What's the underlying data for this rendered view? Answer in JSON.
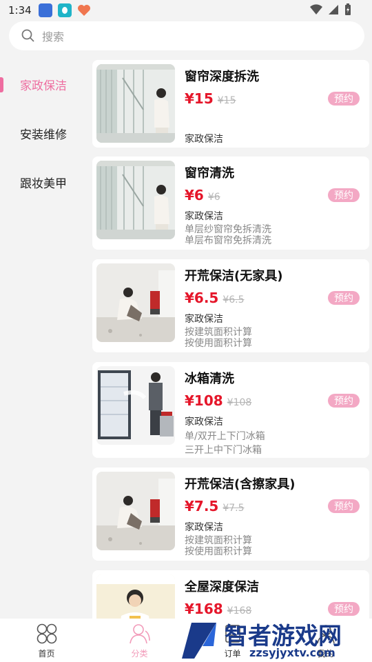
{
  "status_bar": {
    "time": "1:34"
  },
  "search": {
    "placeholder": "搜索"
  },
  "sidebar": {
    "items": [
      {
        "label": "家政保洁",
        "active": true
      },
      {
        "label": "安装维修",
        "active": false
      },
      {
        "label": "跟妆美甲",
        "active": false
      }
    ]
  },
  "cards": [
    {
      "title": "窗帘深度拆洗",
      "price": "¥15",
      "old_price": "¥15",
      "book": "预约",
      "category": "家政保洁",
      "desc": []
    },
    {
      "title": "窗帘清洗",
      "price": "¥6",
      "old_price": "¥6",
      "book": "预约",
      "category": "家政保洁",
      "desc": [
        "单层纱窗帘免拆清洗",
        "单层布窗帘免拆清洗"
      ]
    },
    {
      "title": "开荒保洁(无家具)",
      "price": "¥6.5",
      "old_price": "¥6.5",
      "book": "预约",
      "category": "家政保洁",
      "desc": [
        "按建筑面积计算",
        "按使用面积计算"
      ]
    },
    {
      "title": "冰箱清洗",
      "price": "¥108",
      "old_price": "¥108",
      "book": "预约",
      "category": "家政保洁",
      "desc": [
        "单/双开上下门冰箱",
        "三开上中下门冰箱"
      ]
    },
    {
      "title": "开荒保洁(含擦家具)",
      "price": "¥7.5",
      "old_price": "¥7.5",
      "book": "预约",
      "category": "家政保洁",
      "desc": [
        "按建筑面积计算",
        "按使用面积计算"
      ]
    },
    {
      "title": "全屋深度保洁",
      "price": "¥168",
      "old_price": "¥168",
      "book": "预约",
      "category": "",
      "desc": []
    }
  ],
  "bottom_nav": [
    {
      "label": "首页",
      "icon": "grid-icon",
      "active": false
    },
    {
      "label": "分类",
      "icon": "person-icon",
      "active": true
    },
    {
      "label": "订单",
      "icon": "order-icon",
      "active": false
    },
    {
      "label": "我的",
      "icon": "user-icon",
      "active": false
    }
  ],
  "watermark": {
    "text": "智者游戏网",
    "url": "zzsyjyxtv.com"
  },
  "colors": {
    "accent": "#ee6da0",
    "price": "#e5162a",
    "badge": "#f3a8c4"
  }
}
